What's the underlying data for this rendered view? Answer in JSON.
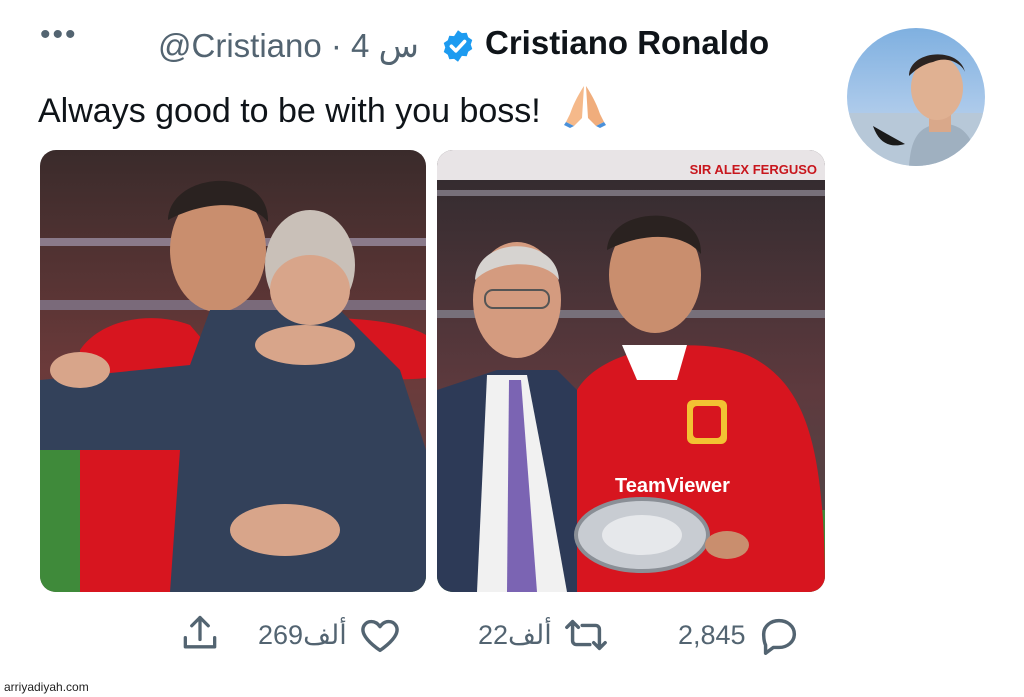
{
  "header": {
    "display_name": "Cristiano Ronaldo",
    "meta": "@Cristiano · 4 س",
    "more_label": "•••"
  },
  "tweet": {
    "text": "Always good to be with you boss!",
    "emoji": "🙏"
  },
  "images": [
    {
      "alt": "hug"
    },
    {
      "alt": "trophy",
      "banner_text": "SIR ALEX FERGUSO",
      "sponsor_text": "TeamViewer"
    }
  ],
  "actions": {
    "replies": "2,845",
    "retweets": "22ألف",
    "likes": "269ألف"
  },
  "watermark": "arriyadiyah.com",
  "colors": {
    "verified": "#1d9bf0",
    "text_secondary": "#536471",
    "united_red": "#d7151f"
  }
}
